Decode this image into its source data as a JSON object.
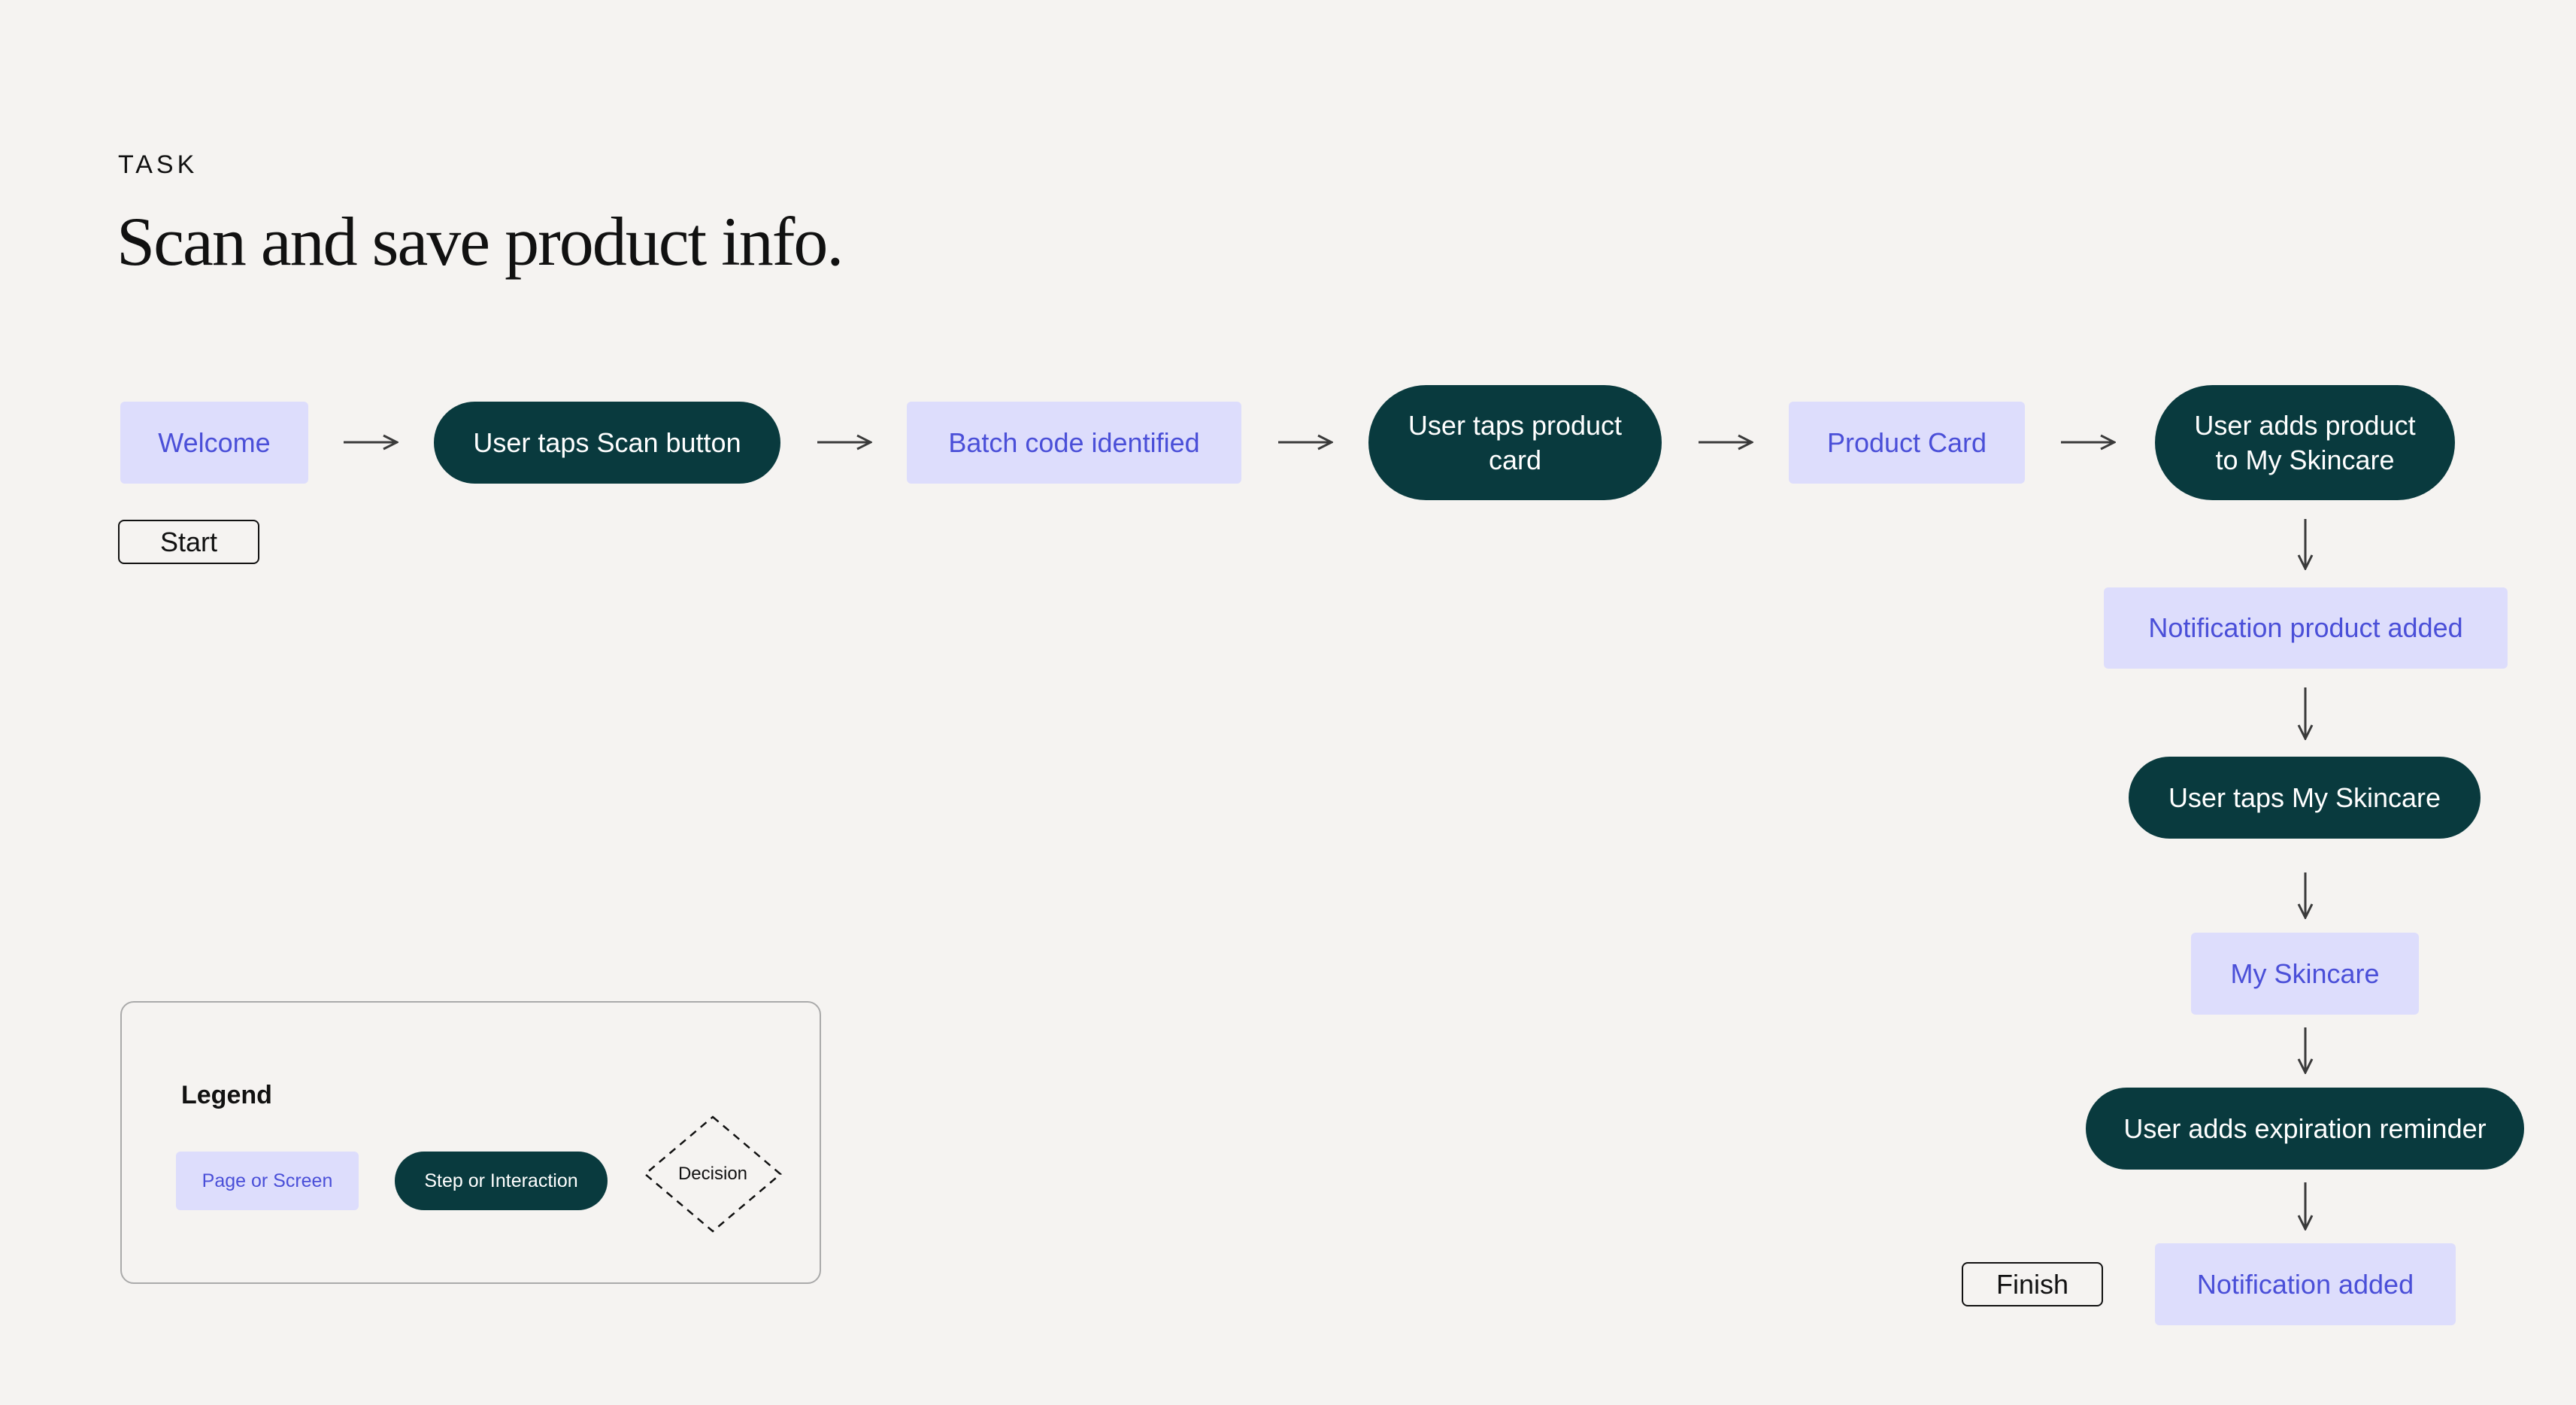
{
  "header": {
    "eyebrow": "TASK",
    "title": "Scan and save product info."
  },
  "flow": {
    "start_label": "Start",
    "finish_label": "Finish",
    "nodes": [
      {
        "kind": "page",
        "label": "Welcome"
      },
      {
        "kind": "step",
        "label": "User taps Scan button"
      },
      {
        "kind": "page",
        "label": "Batch code identified"
      },
      {
        "kind": "step",
        "label": "User taps product\ncard"
      },
      {
        "kind": "page",
        "label": "Product Card"
      },
      {
        "kind": "step",
        "label": "User adds product\nto My Skincare"
      },
      {
        "kind": "page",
        "label": "Notification product added"
      },
      {
        "kind": "step",
        "label": "User taps My Skincare"
      },
      {
        "kind": "page",
        "label": "My Skincare"
      },
      {
        "kind": "step",
        "label": "User adds expiration reminder"
      },
      {
        "kind": "page",
        "label": "Notification added"
      }
    ]
  },
  "legend": {
    "title": "Legend",
    "page_label": "Page or Screen",
    "step_label": "Step or Interaction",
    "decision_label": "Decision"
  },
  "colors": {
    "background": "#F5F3F1",
    "page_fill": "#DDDDFC",
    "page_text": "#4A4FD8",
    "step_fill": "#093A3E",
    "step_text": "#FFFFFF"
  }
}
